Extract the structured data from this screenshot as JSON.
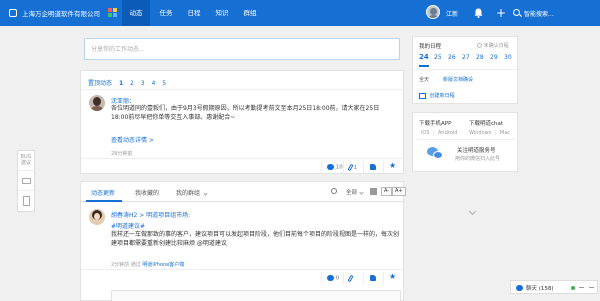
{
  "topbar": {
    "company": "上海万企明道软件有限公司",
    "nav": [
      "动态",
      "任务",
      "日程",
      "知识",
      "群组"
    ],
    "user_name": "江新",
    "search_placeholder": "智能搜索..."
  },
  "sidetool": {
    "bug_label_1": "BUG",
    "bug_label_2": "建议"
  },
  "share": {
    "placeholder": "分享你的工作动态..."
  },
  "top_posts": {
    "title": "置顶动态",
    "pages": [
      "1",
      "2",
      "3",
      "4",
      "5"
    ],
    "post": {
      "author": "沈亚丽：",
      "body": "各位明道同的壹毅们，由于9月3号假期原因，所以考勤提考前文至本月25日18:00前，请大家在25日18:00前尽早把你单等交互入事部。惠谢配合~",
      "link": "查看动态详情 >",
      "time": "28分钟前",
      "comments": "10",
      "attachments": "1"
    }
  },
  "feed": {
    "tabs": [
      "动态更新",
      "我收藏的",
      "我的群组"
    ],
    "filter_all": "全部",
    "font_smaller": "A-",
    "font_larger": "A+",
    "post": {
      "author": "胡春涛H2 > 明道项目组市场:",
      "tag": "#明道建议#",
      "body": "我样还一车做那致的事的客户，建议项目可以发起项目阶段，他们目前每个项目的阶段视图是一样的，每次创建项目都需要重新创建比较麻烦 @明道建议",
      "time": "2分钟前",
      "via_prefix": "通过",
      "via": "明道iPhone客户端",
      "comments": "0"
    }
  },
  "schedule": {
    "title": "我的日程",
    "unread": "未确认日程",
    "days": [
      "24",
      "25",
      "26",
      "27",
      "28",
      "29",
      "30"
    ],
    "allday": "全天",
    "event": "新版文档确设",
    "create": "创建新日程"
  },
  "apps": {
    "mobile_title": "下载手机APP",
    "client_title": "下载明道chat",
    "os": [
      "iOS",
      "Android",
      "Windows",
      "Mac"
    ],
    "follow_title": "关注明道服务号",
    "follow_sub": "用你的微信扫入此号"
  },
  "chat": {
    "label": "聊天 (158)"
  },
  "colors": {
    "primary": "#1670d4",
    "topbar_active": "#0b5cb8",
    "online": "#3cb34a"
  }
}
